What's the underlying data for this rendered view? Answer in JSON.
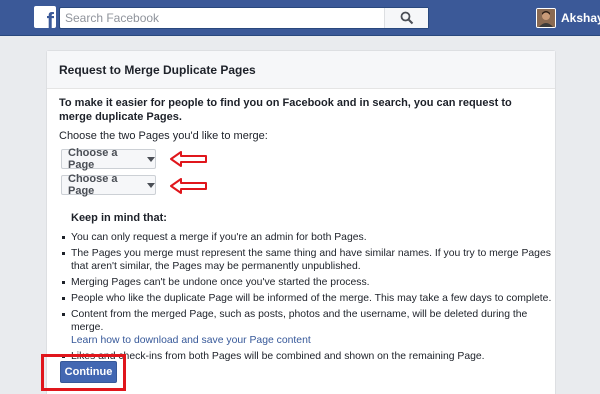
{
  "topbar": {
    "logo_letter": "f",
    "search_placeholder": "Search Facebook",
    "user_name": "Akshay"
  },
  "card": {
    "title": "Request to Merge Duplicate Pages",
    "intro": "To make it easier for people to find you on Facebook and in search, you can request to merge duplicate Pages.",
    "choose_label": "Choose the two Pages you'd like to merge:",
    "dropdowns": [
      {
        "label": "Choose a Page"
      },
      {
        "label": "Choose a Page"
      }
    ],
    "keep_in_mind": "Keep in mind that:",
    "rules": [
      "You can only request a merge if you're an admin for both Pages.",
      "The Pages you merge must represent the same thing and have similar names. If you try to merge Pages that aren't similar, the Pages may be permanently unpublished.",
      "Merging Pages can't be undone once you've started the process.",
      "People who like the duplicate Page will be informed of the merge. This may take a few days to complete.",
      "Content from the merged Page, such as posts, photos and the username, will be deleted during the merge."
    ],
    "rule_link": "Learn how to download and save your Page content",
    "last_rule": "Likes and check-ins from both Pages will be combined and shown on the remaining Page.",
    "continue_label": "Continue"
  },
  "colors": {
    "brand": "#3b5998",
    "button": "#4267b2",
    "annotation_red": "#e0161c"
  },
  "icons": {
    "logo": "facebook-logo-icon",
    "search": "search-icon",
    "caret": "caret-down-icon",
    "annotation": "red-arrow-icon"
  }
}
